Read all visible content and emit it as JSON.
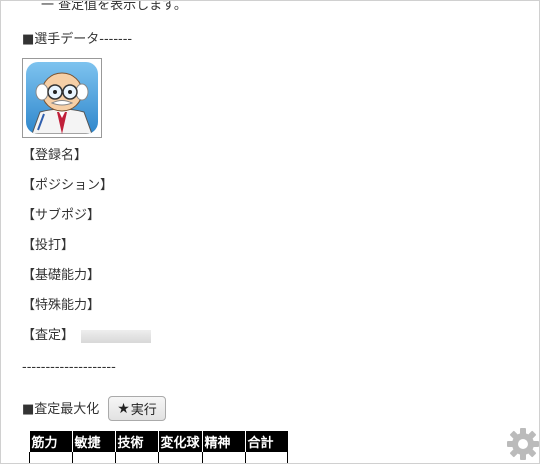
{
  "top_cut_text": "一 查定值を表示します。",
  "section_player": "■選手データ-------",
  "fields": {
    "register_name": "【登録名】",
    "position": "【ポジション】",
    "sub_position": "【サブポジ】",
    "throw_bat": "【投打】",
    "basic_ability": "【基礎能力】",
    "special_ability": "【特殊能力】",
    "assessment": "【査定】"
  },
  "separator": "--------------------",
  "maximize": {
    "label": "■査定最大化",
    "button_label": "実行",
    "button_icon": "star-icon"
  },
  "stats_table": {
    "headers": [
      "筋力",
      "敏捷",
      "技術",
      "変化球",
      "精神",
      "合計"
    ],
    "colors": {
      "header_bg": "#000000",
      "header_fg": "#ffffff"
    }
  },
  "settings_icon": "gear-icon",
  "colors": {
    "text": "#333333",
    "gear": "#bbbbbb"
  }
}
